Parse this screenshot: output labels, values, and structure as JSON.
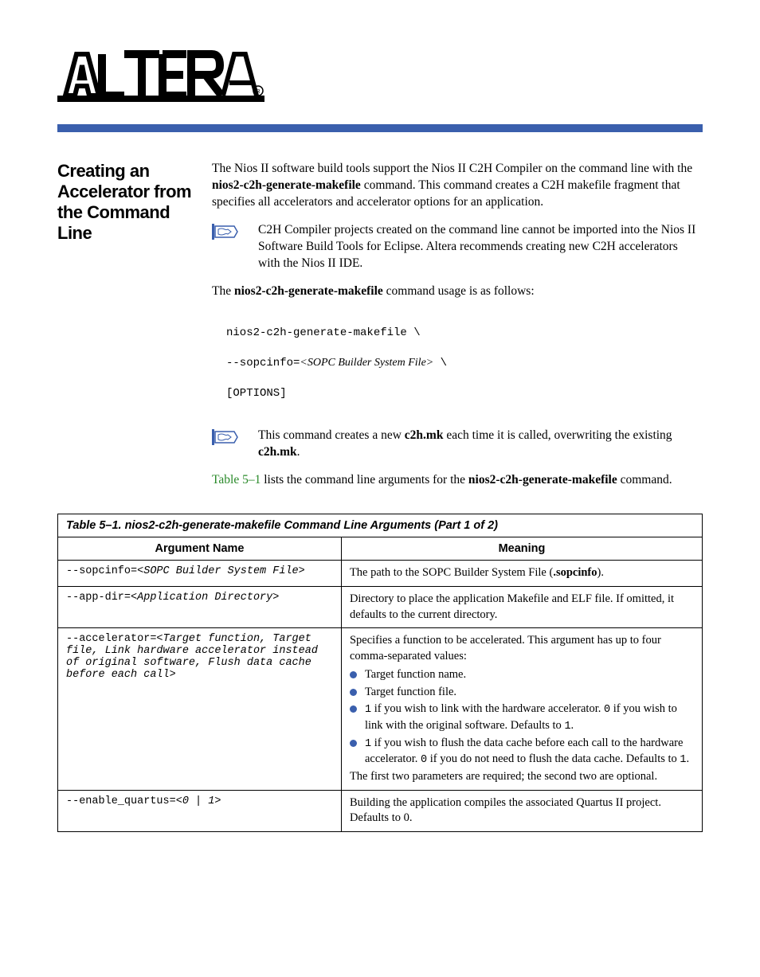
{
  "brand": {
    "logo_name": "ALTERA",
    "color_accent": "#3a5fad"
  },
  "heading": "Creating an Accelerator from the Command Line",
  "para1_parts": {
    "a": "The Nios II software build tools support the Nios II C2H Compiler on the command line with the ",
    "cmd1": "nios2-c2h-generate-makefile",
    "b": " command. This command creates a C2H makefile fragment that specifies all accelerators and accelerator options for an application."
  },
  "note1": "C2H Compiler projects created on the command line cannot be imported into the Nios II Software Build Tools for Eclipse. Altera recommends creating new C2H accelerators with the Nios II IDE.",
  "para2_parts": {
    "a": "The ",
    "cmd": "nios2-c2h-generate-makefile",
    "b": " command usage is as follows:"
  },
  "cmd_block": {
    "line1": "nios2-c2h-generate-makefile \\",
    "line2a": "    --sopcinfo=",
    "line2b": "<SOPC Builder System File>",
    "line2c": " \\",
    "line3": "    [OPTIONS]"
  },
  "note2_parts": {
    "a": "This command creates a new ",
    "file1": "c2h.mk",
    "b": " each time it is called, overwriting the existing ",
    "file2": "c2h.mk",
    "c": "."
  },
  "para3_parts": {
    "xref": "Table 5–1",
    "a": " lists the command line arguments for the ",
    "cmd": "nios2-c2h-generate-makefile",
    "b": " command."
  },
  "table": {
    "caption": "Table 5–1. nios2-c2h-generate-makefile Command Line Arguments  (Part 1 of 2)",
    "headers": {
      "col1": "Argument Name",
      "col2": "Meaning"
    },
    "rows": [
      {
        "arg": "--sopcinfo=<SOPC Builder System File>",
        "meaning": "The path to the SOPC Builder System File (.sopcinfo)."
      },
      {
        "arg": "--app-dir=<Application Directory>",
        "meaning_parts": {
          "a": "Directory to place the application Makefile and ELF file. If omitted, it defaults to the current directory."
        }
      },
      {
        "arg": "--accelerator=<Target function, Target file, Link hardware accelerator instead of original software, Flush data cache before each call>",
        "meaning_intro": "Specifies a function to be accelerated. This argument has up to four comma-separated values:",
        "list": [
          "Target function name.",
          "Target function file.",
          "1 if you wish to link with the hardware accelerator. 0 if you wish to link with the original software. Defaults to 1.",
          "1 if you wish to flush the data cache before each call to the hardware accelerator. 0 if you do not need to flush the data cache. Defaults to 1."
        ],
        "meaning_outro": "The first two parameters are required; the second two are optional."
      },
      {
        "arg": "--enable_quartus=<0 | 1>",
        "meaning_parts": {
          "a": "Building the application compiles the associated Quartus II project. Defaults to 0."
        }
      }
    ]
  }
}
